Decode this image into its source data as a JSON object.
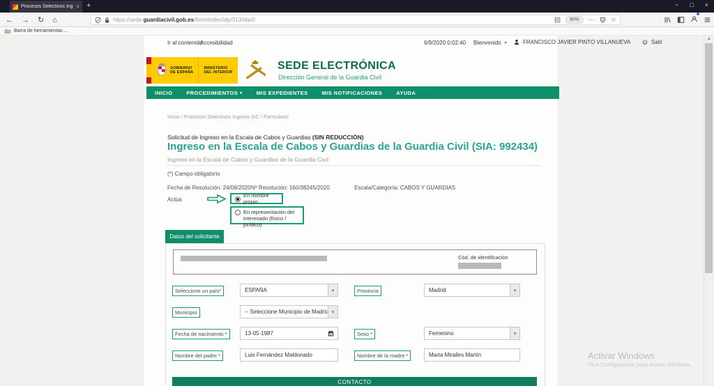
{
  "browser": {
    "tab_title": "Procesos Selectivos Ingreso GC",
    "url_prefix": "https://sede.",
    "url_domain": "guardiacivil.gob.es",
    "url_path": "/form/index/idp/313/ida/0",
    "zoom_level": "90%",
    "bookmarks_bar_label": "Barra de herramientas ..."
  },
  "icons": {
    "back": "←",
    "forward": "→",
    "reload": "↻",
    "home": "⌂",
    "new_tab": "+",
    "close_tab": "×",
    "minimize": "−",
    "maximize": "□",
    "close_window": "×",
    "overflow": "⋯",
    "star": "☆",
    "caret_down": "▾",
    "scroll_up": "▲"
  },
  "header": {
    "skip_link": "Ir al contenido",
    "accessibility_link": "Accesibilidad",
    "datetime": "6/9/2020 0:02:40",
    "welcome_label": "Bienvenido",
    "user_name": "FRANCISCO JAVIER PINTO VILLANUEVA",
    "logout_label": "Salir",
    "gov_line1": "GOBIERNO",
    "gov_line2": "DE ESPAÑA",
    "ministry_line1": "MINISTERIO",
    "ministry_line2": "DEL INTERIOR",
    "site_title": "SEDE ELECTRÓNICA",
    "site_subtitle": "Dirección General de la Guardia Civil"
  },
  "nav": {
    "items": [
      {
        "label": "INICIO"
      },
      {
        "label": "PROCEDIMIENTOS"
      },
      {
        "label": "MIS EXPEDIENTES"
      },
      {
        "label": "MIS NOTIFICACIONES"
      },
      {
        "label": "AYUDA"
      }
    ]
  },
  "page": {
    "breadcrumb": "Inicio / Procesos Selectivos Ingreso GC / Formulario",
    "pretitle": "Solicitud de Ingreso en la Escala de Cabos y Guardias ",
    "pretitle_bold": "(SIN REDUCCIÓN)",
    "title": "Ingreso en la Escala de Cabos y Guardias de la Guardia Civil (SIA: 992434)",
    "subtitle": "Ingreso en la Escala de Cabos y Guardias de la Guardia Civil",
    "required_note": "(*) Campo obligatorio",
    "resolution_date_label": "Fecha de Resolución:",
    "resolution_date": "24/08/2020",
    "resolution_number_label": "Nº Resolución:",
    "resolution_number": "160/38245/2020",
    "scale_label": "Escala/Categoría:",
    "scale_value": "CABOS Y GUARDIAS",
    "acts_label": "Actúa",
    "radio_option1": "En nombre propio",
    "radio_option2_line1": "En representación del",
    "radio_option2_line2": "interesado (físico / jurídico)"
  },
  "form": {
    "tab_label": "Datos del solicitante",
    "id_code_label": "Cód. de identificación",
    "country_label": "Seleccione un país*",
    "country_value": "ESPAÑA",
    "province_label": "Provincia",
    "province_value": "Madrid",
    "municipality_label": "Municipio",
    "municipality_value": "-- Seleccione Municipio de Madrid",
    "birthdate_label": "Fecha de nacimiento *",
    "birthdate_value": "13-05-1987",
    "sex_label": "Sexo *",
    "sex_value": "Femenino",
    "father_label": "Nombre del padre *",
    "father_value": "Luis Fernández Maldonado",
    "mother_label": "Nombre de la madre *",
    "mother_value": "Marta Miralles Martín",
    "contact_bar_label": "CONTACTO"
  },
  "watermark": {
    "line1": "Activar Windows",
    "line2": "Ve a Configuración para activar Windows."
  },
  "colors": {
    "nav_green": "#0e8e69",
    "dark_green": "#0b6b4e",
    "title_teal": "#2ba295",
    "annotation_green": "#199b7c"
  }
}
